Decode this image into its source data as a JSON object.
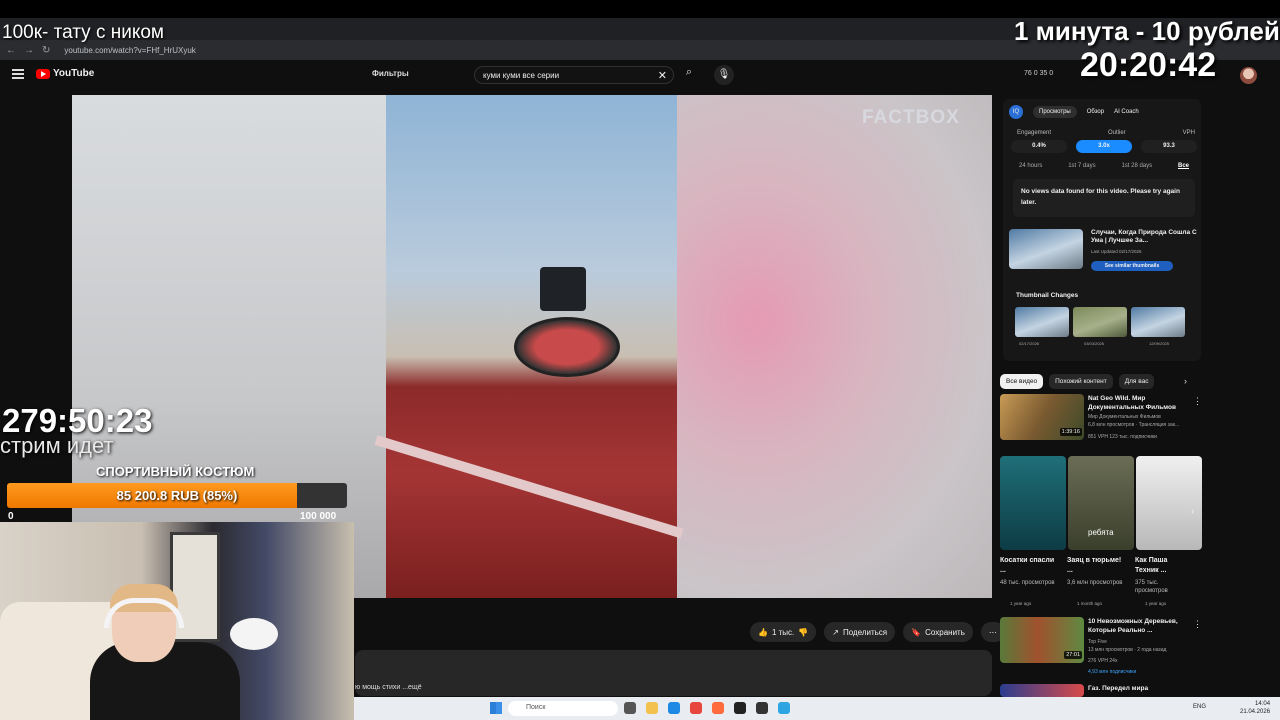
{
  "browser": {
    "url": "youtube.com/watch?v=FHf_HrUXyuk"
  },
  "youtube": {
    "logo": "YouTube",
    "filters_label": "Фильтры",
    "search_value": "куми куми все серии",
    "header_stats": "76  0  35  0"
  },
  "video": {
    "watermark": "FACTBOX",
    "likes": "1 тыс.",
    "share_label": "Поделиться",
    "save_label": "Сохранить",
    "description_snippet": "ю мощь стихи ...ещё"
  },
  "panel": {
    "tabs": [
      "Просмотры",
      "Обзор",
      "AI Coach"
    ],
    "metric_labels": [
      "Engagement",
      "Outlier",
      "VPH"
    ],
    "metric_values": [
      "0.4%",
      "3.0x",
      "93.3"
    ],
    "periods": [
      "24 hours",
      "1st 7 days",
      "1st 28 days",
      "Все"
    ],
    "no_data": "No views data found for this video. Please try again later.",
    "thumb_title": "Случаи, Когда Природа Сошла С Ума | Лучшее За...",
    "thumb_updated": "Last Updated 02/17/2026",
    "similar_label": "See similar thumbnails",
    "tc_title": "Thumbnail Changes",
    "tc_dates": [
      "02/17/2026",
      "03/03/2026",
      "12/09/2025"
    ]
  },
  "recs": {
    "chips": [
      "Все видео",
      "Похожий контент",
      "Для вас"
    ],
    "items": [
      {
        "title": "Nat Geo Wild. Мир Документальных Фильмов",
        "meta1": "Мир Документальных Фильмов",
        "meta2": "6,8 млн просмотров · Трансляция зак...",
        "meta3": "851 VPH   123 тыс. подписчики",
        "duration": "1:39:16"
      },
      {
        "title": "10 Невозможных Деревьев, Которые Реально ...",
        "meta1": "Top Five",
        "meta2": "13 млн просмотров · 2 года назад",
        "meta3": "276 VPH  24x",
        "meta4": "4,93 млн подписчики",
        "duration": "27:01"
      },
      {
        "title": "Газ. Передел мира"
      }
    ],
    "shorts": [
      {
        "title": "Косатки спасли ...",
        "views": "48 тыс. просмотров",
        "date": "1 year ago"
      },
      {
        "title": "Заяц в тюрьме! ...",
        "views": "3,6 млн просмотров",
        "date": "1 month ago"
      },
      {
        "title": "Как Паша Техник ...",
        "views": "375 тыс. просмотров",
        "date": "1 year ago"
      }
    ],
    "short_caption": "ребята"
  },
  "overlay": {
    "title": "100к- тату с ником",
    "price": "1 минута - 10 рублей",
    "clock": "20:20:42",
    "stream_timer": "279:50:23",
    "stream_status": "стрим идет",
    "goal_title": "СПОРТИВНЫЙ КОСТЮМ",
    "goal_text": "85 200.8 RUB (85%)",
    "goal_progress": 0.852,
    "goal_min": "0",
    "goal_max": "100 000"
  },
  "taskbar": {
    "search_placeholder": "Поиск",
    "lang": "ENG",
    "time": "14:04",
    "date": "21.04.2026"
  }
}
